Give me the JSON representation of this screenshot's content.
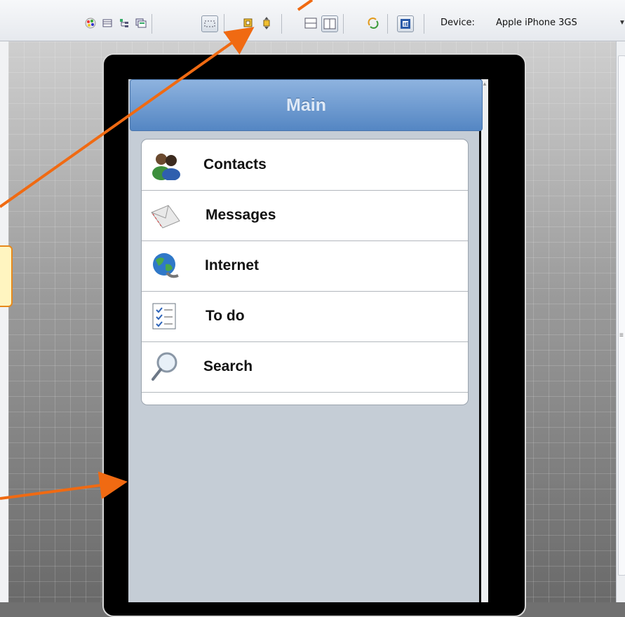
{
  "toolbar": {
    "device_label": "Device:",
    "device_value": "Apple iPhone 3GS",
    "buttons": [
      {
        "name": "palette-icon"
      },
      {
        "name": "grid-icon"
      },
      {
        "name": "tree-icon"
      },
      {
        "name": "layers-icon"
      },
      {
        "name": "selection-rect-icon"
      },
      {
        "name": "resize-icon"
      },
      {
        "name": "move-icon"
      },
      {
        "name": "split-horizontal-icon"
      },
      {
        "name": "split-vertical-icon"
      },
      {
        "name": "refresh-icon"
      },
      {
        "name": "ie-preview-icon"
      }
    ]
  },
  "app": {
    "title": "Main",
    "items": [
      {
        "label": "Contacts",
        "icon": "contacts-icon"
      },
      {
        "label": "Messages",
        "icon": "envelope-icon"
      },
      {
        "label": "Internet",
        "icon": "globe-icon"
      },
      {
        "label": "To do",
        "icon": "checklist-icon"
      },
      {
        "label": "Search",
        "icon": "magnifier-icon"
      }
    ]
  },
  "colors": {
    "annotation_arrow": "#f06a12",
    "nav_bar": "#5f8fcb",
    "callout_fill": "#fff5c0",
    "callout_border": "#e7891c"
  }
}
